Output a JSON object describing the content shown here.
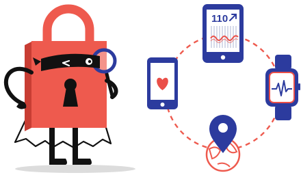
{
  "illustration": {
    "phone_display": {
      "reading": "110",
      "trend_icon": "arrow-up-right-icon"
    },
    "phone_app_icon": "heart-icon",
    "watch_display_icon": "heartbeat-pulse-icon",
    "location_icon": "map-pin-icon",
    "globe_icon": "globe-icon",
    "character": "padlock-burglar-with-magnifying-glass",
    "colors": {
      "lock_red": "#ee5a4e",
      "lock_dark_red": "#c83d33",
      "navy": "#2c3b9e",
      "black": "#111111",
      "connector_dash": "#ee5a4e",
      "screen_red": "#ea4f48",
      "shadow": "#dcdcdc"
    }
  }
}
